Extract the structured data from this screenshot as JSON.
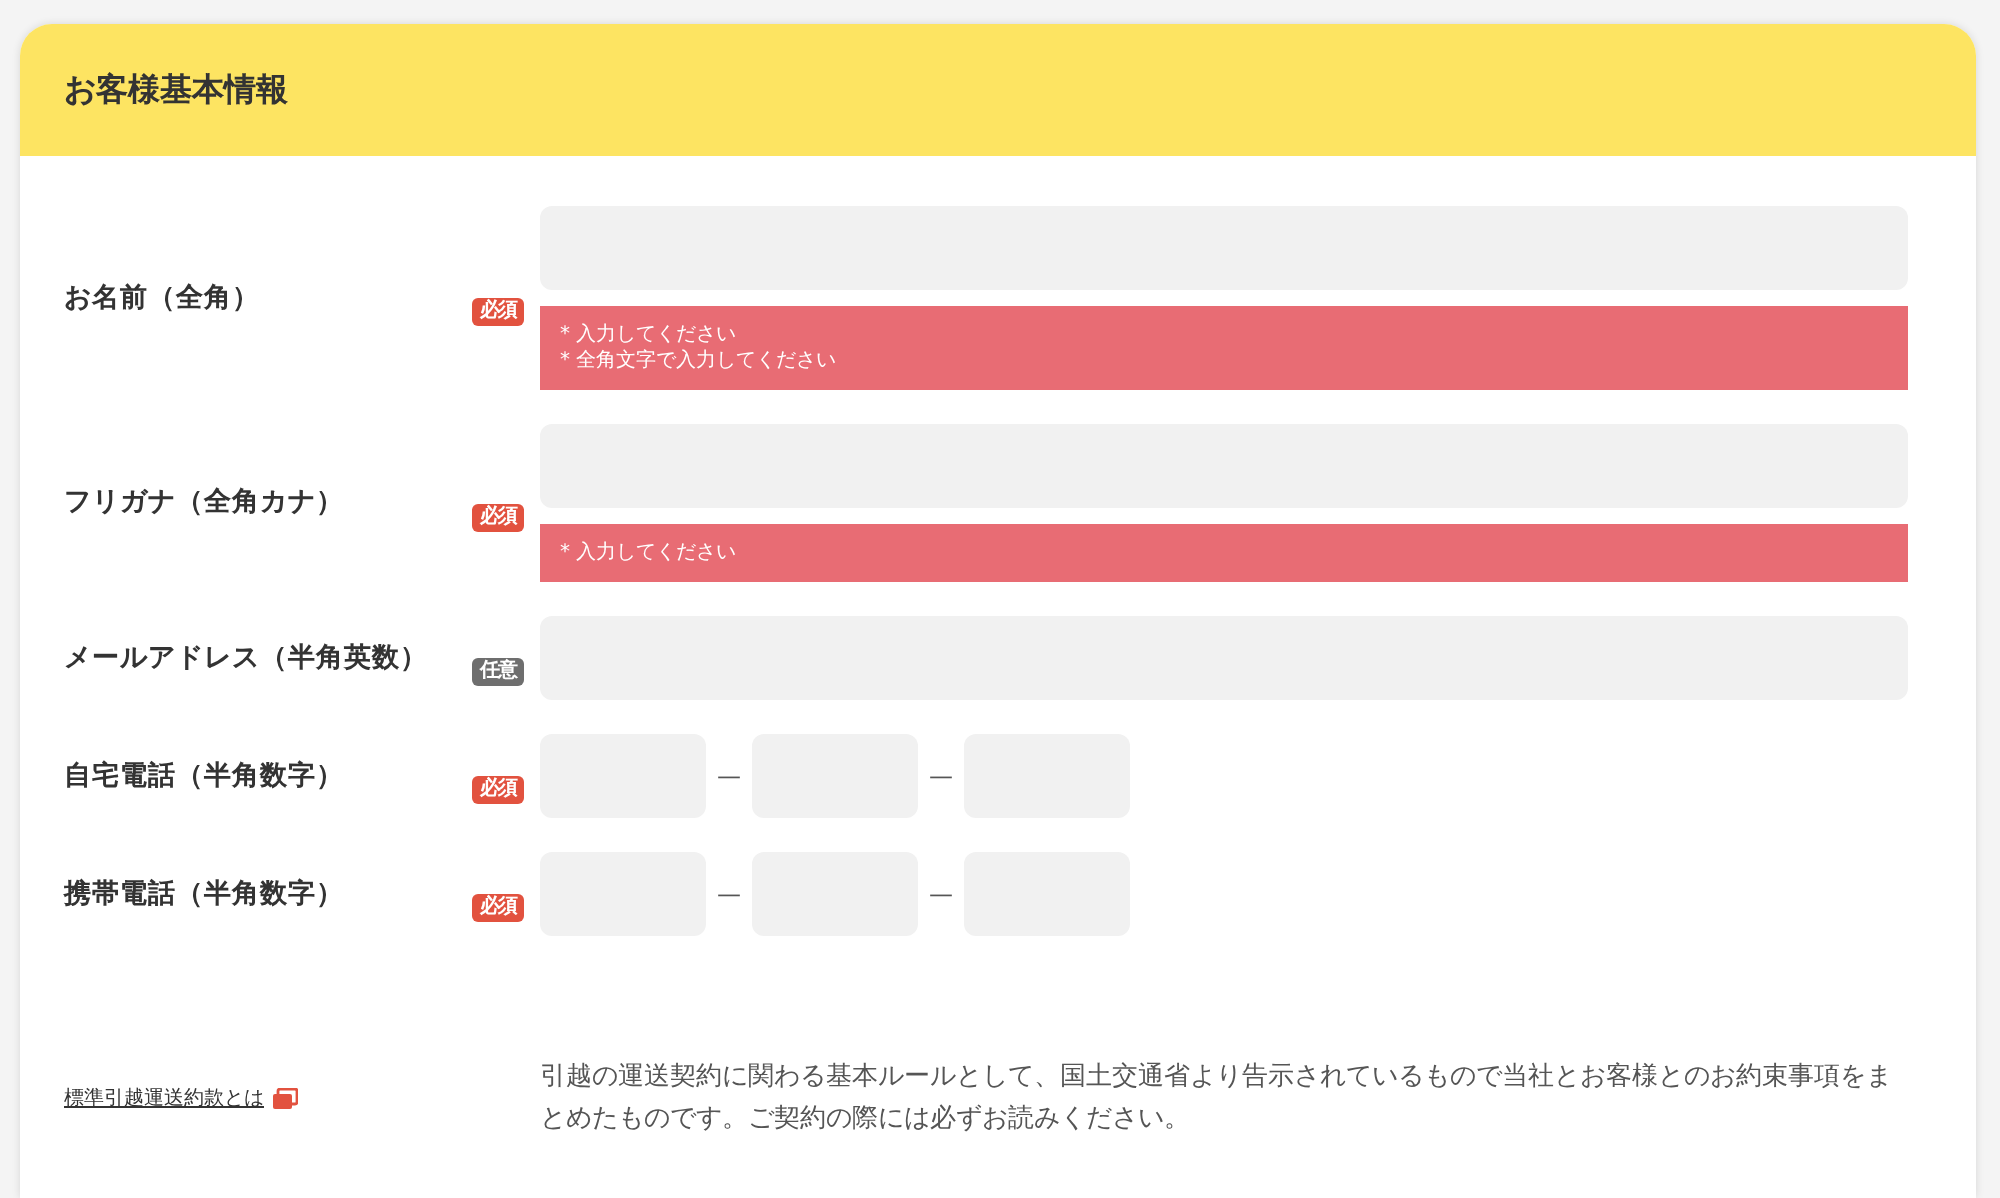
{
  "section": {
    "title": "お客様基本情報"
  },
  "fields": [
    {
      "label": "お名前（全角）",
      "badge": "必須",
      "required": true,
      "kind": "text",
      "errors": [
        "* 入力してください",
        "* 全角文字で入力してください"
      ]
    },
    {
      "label": "フリガナ（全角カナ）",
      "badge": "必須",
      "required": true,
      "kind": "text",
      "errors": [
        "* 入力してください"
      ]
    },
    {
      "label": "メールアドレス（半角英数）",
      "badge": "任意",
      "required": false,
      "kind": "text"
    },
    {
      "label": "自宅電話（半角数字）",
      "badge": "必須",
      "required": true,
      "kind": "phone",
      "separators": [
        "—",
        "—"
      ]
    },
    {
      "label": "携帯電話（半角数字）",
      "badge": "必須",
      "required": true,
      "kind": "phone",
      "separators": [
        "—",
        "—"
      ]
    }
  ],
  "footer": {
    "link": "標準引越運送約款とは",
    "description": "引越の運送契約に関わる基本ルールとして、国土交通省より告示されているもので当社とお客様とのお約束事項をまとめたものです。ご契約の際には必ずお読みください。"
  }
}
